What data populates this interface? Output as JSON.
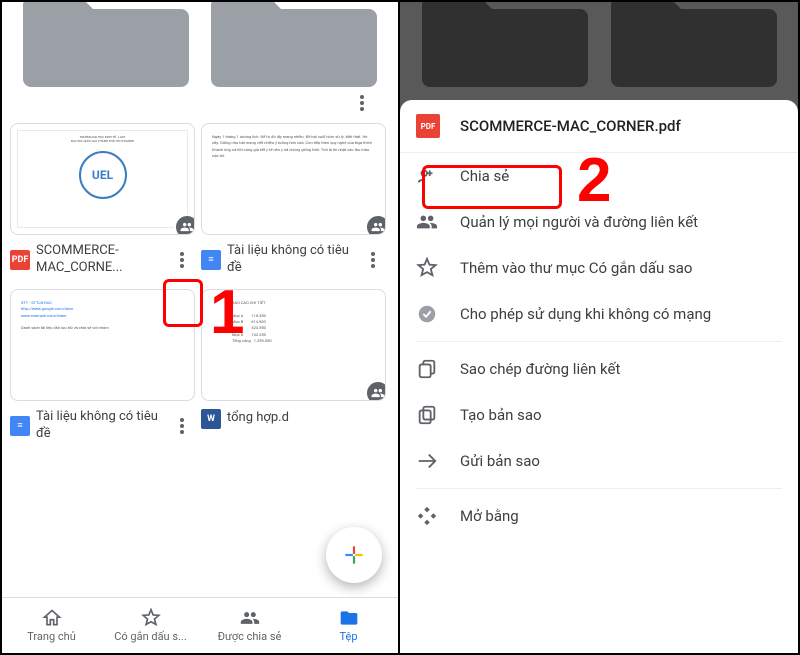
{
  "left": {
    "files": [
      {
        "name": "SCOMMERCE-MAC_CORNE...",
        "icon": "pdf",
        "shared": true
      },
      {
        "name": "Tài liệu không có tiêu đề",
        "icon": "doc",
        "shared": true
      },
      {
        "name": "Tài liệu không có tiêu đề",
        "icon": "doc",
        "shared": false
      },
      {
        "name": "tổng hợp.d",
        "icon": "word",
        "shared": true
      }
    ],
    "nav": {
      "home": "Trang chủ",
      "starred": "Có gắn dấu s...",
      "shared": "Được chia sẻ",
      "files": "Tệp"
    }
  },
  "right": {
    "title": "SCOMMERCE-MAC_CORNER.pdf",
    "items": {
      "share": "Chia sẻ",
      "manage": "Quản lý mọi người và đường liên kết",
      "star": "Thêm vào thư mục Có gắn dấu sao",
      "offline": "Cho phép sử dụng khi không có mạng",
      "copylink": "Sao chép đường liên kết",
      "makecopy": "Tạo bản sao",
      "sendcopy": "Gửi bản sao",
      "openwith": "Mở bằng"
    }
  },
  "annotations": {
    "one": "1",
    "two": "2"
  }
}
